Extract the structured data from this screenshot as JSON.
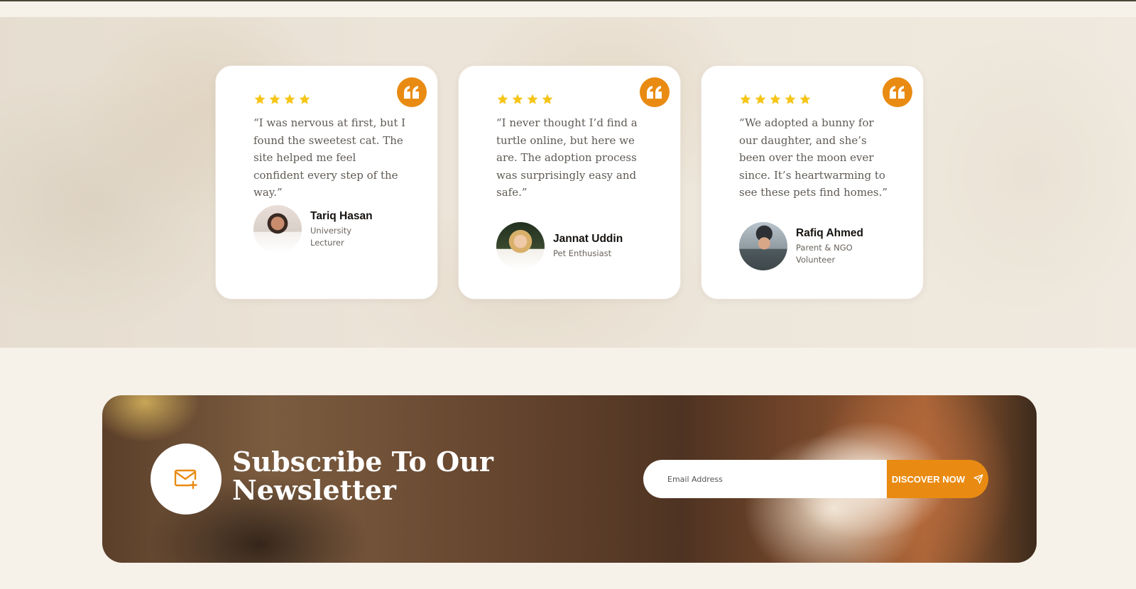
{
  "colors": {
    "accent": "#e98b12",
    "star": "#f5c518",
    "card_bg": "#ffffff",
    "page_bg": "#f6f1e9"
  },
  "testimonials": [
    {
      "rating": 4,
      "quote": "“I was nervous at first, but I found the sweetest cat. The site helped me feel confident every step of the way.”",
      "name": "Tariq Hasan",
      "role": "University Lecturer",
      "icon": "quote-icon"
    },
    {
      "rating": 4,
      "quote": "“I never thought I’d find a turtle online, but here we are. The adoption process was surprisingly easy and safe.”",
      "name": "Jannat Uddin",
      "role": "Pet Enthusiast",
      "icon": "quote-icon"
    },
    {
      "rating": 5,
      "quote": "“We adopted a bunny for our daughter, and she’s been over the moon ever since. It’s heartwarming to see these pets find homes.”",
      "name": "Rafiq Ahmed",
      "role": "Parent & NGO Volunteer",
      "icon": "quote-icon"
    }
  ],
  "newsletter": {
    "title": "Subscribe To Our Newsletter",
    "email_placeholder": "Email Address",
    "button_label": "DISCOVER NOW",
    "icon": "mail-plus-icon",
    "button_icon": "send-icon"
  }
}
